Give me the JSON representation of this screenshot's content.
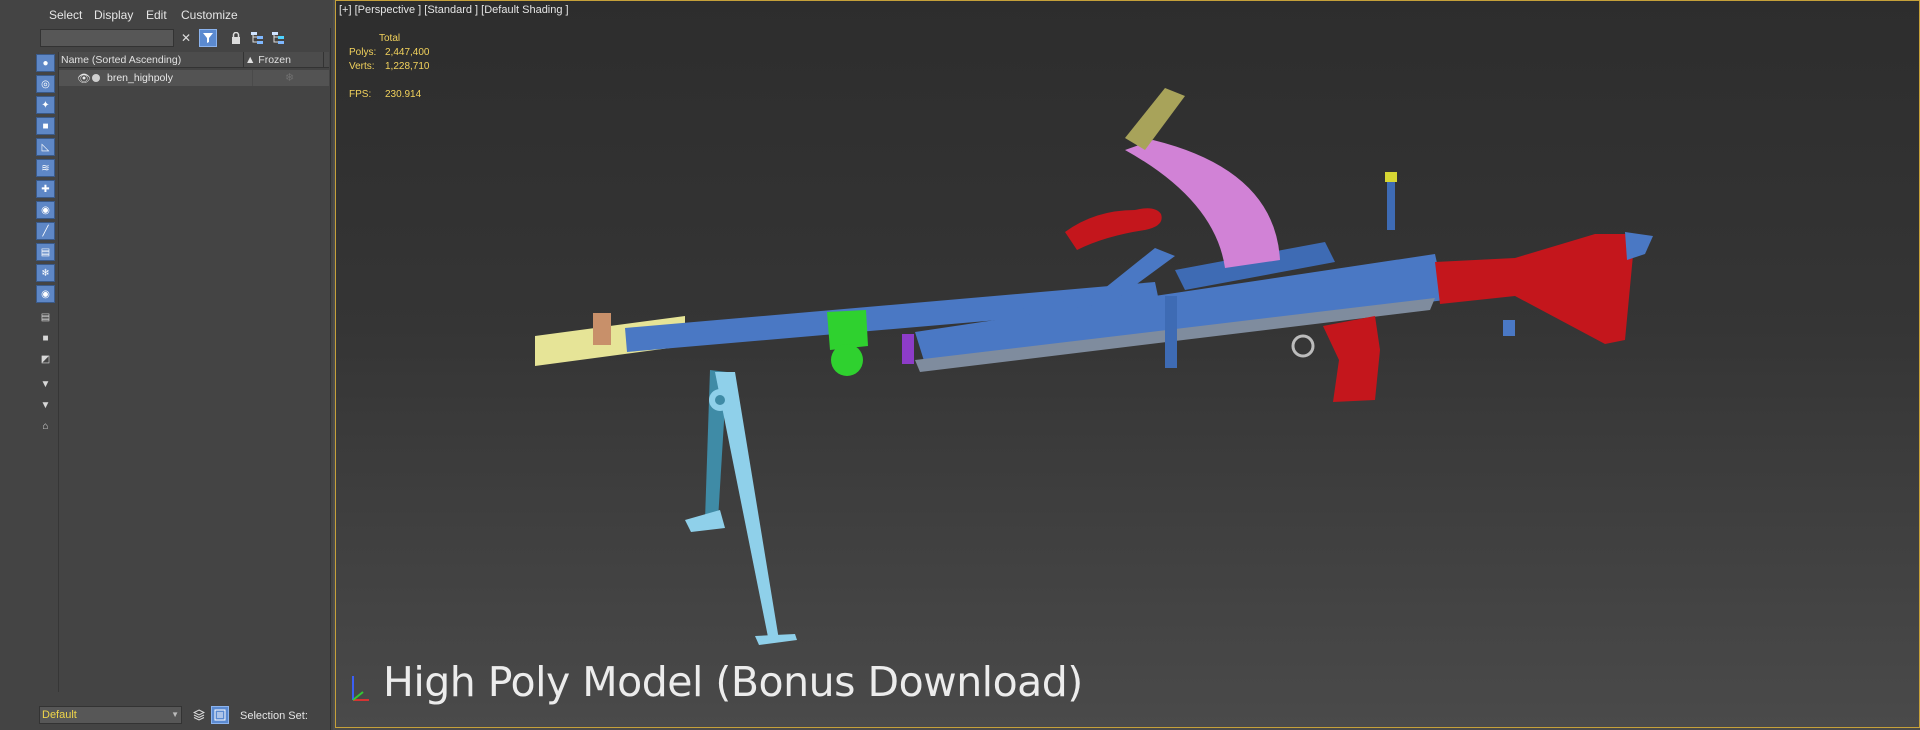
{
  "menu": {
    "items": [
      "Select",
      "Display",
      "Edit",
      "Customize"
    ]
  },
  "explorer": {
    "header": {
      "name_col": "Name (Sorted Ascending)",
      "frozen_col": "▲ Frozen"
    },
    "rows": [
      {
        "name": "bren_highpoly"
      }
    ],
    "layer": "Default",
    "selection_set_label": "Selection Set:"
  },
  "viewport": {
    "label": "[+] [Perspective ] [Standard ] [Default Shading ]",
    "stats": {
      "total_label": "Total",
      "polys_label": "Polys:",
      "polys_value": "2,447,400",
      "verts_label": "Verts:",
      "verts_value": "1,228,710",
      "fps_label": "FPS:",
      "fps_value": "230.914"
    },
    "caption": "High Poly Model (Bonus Download)"
  },
  "colors": {
    "barrel": "#4a78c4",
    "stock": "#c4161c",
    "magazine": "#d182d6",
    "flash_hider": "#e6e497",
    "clamp": "#2fd12f",
    "bipod": "#8fd0ea",
    "stats_text": "#f2d25c",
    "viewport_border": "#c6a13a"
  },
  "icons": {
    "toolbar": [
      "clear-icon",
      "filter-icon",
      "lock-icon",
      "hierarchy-icon",
      "hierarchy-select-icon"
    ],
    "strip": [
      "sphere-icon",
      "shapes-icon",
      "light-icon",
      "camera-icon",
      "helper-icon",
      "spacewarp-icon",
      "group-icon",
      "xref-icon",
      "bone-icon",
      "container-icon",
      "frozen-icon",
      "hidden-icon",
      "display-all-icon",
      "display-none-icon",
      "invert-icon",
      "filter-funnel-icon",
      "funnel-icon",
      "scene-icon"
    ]
  }
}
